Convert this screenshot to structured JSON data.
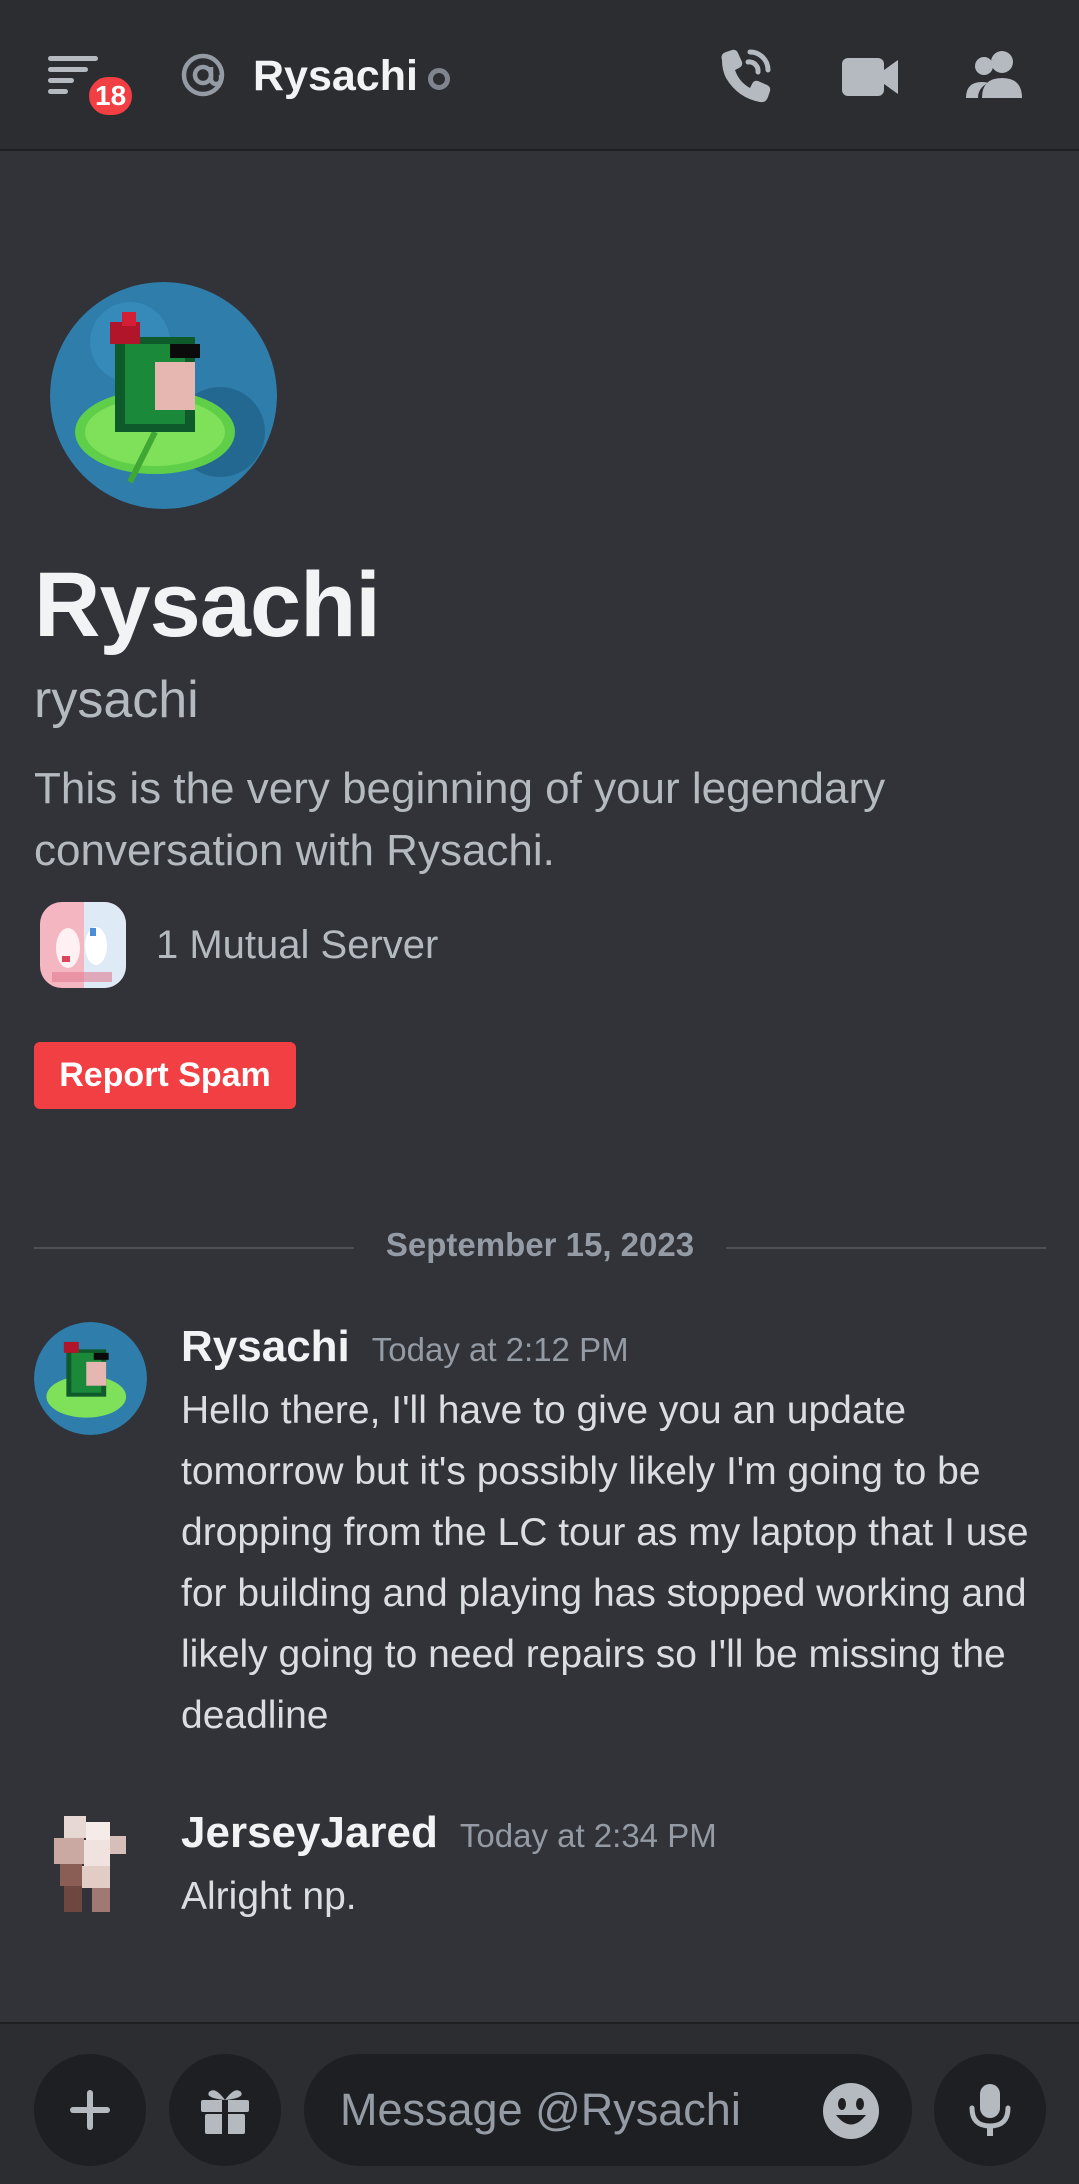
{
  "header": {
    "notification_count": "18",
    "title": "Rysachi",
    "icons": [
      "hamburger-menu-icon",
      "at-icon",
      "phone-call-icon",
      "video-camera-icon",
      "members-icon"
    ]
  },
  "intro": {
    "display_name": "Rysachi",
    "username": "rysachi",
    "description": "This is the very beginning of your legendary conversation with Rysachi.",
    "mutual_servers": "1 Mutual Server",
    "report_button": "Report Spam"
  },
  "divider": {
    "date": "September 15, 2023"
  },
  "messages": [
    {
      "author": "Rysachi",
      "time": "Today at 2:12 PM",
      "text": "Hello there, I'll have to give you an update tomorrow but it's possibly likely I'm going to be dropping from the LC tour as my laptop that I use for building and playing has stopped working and likely going to need repairs so I'll be missing the deadline"
    },
    {
      "author": "JerseyJared",
      "time": "Today at 2:34 PM",
      "text": "Alright np."
    }
  ],
  "composer": {
    "placeholder": "Message @Rysachi",
    "icons": [
      "plus-icon",
      "gift-icon",
      "emoji-icon",
      "microphone-icon"
    ]
  },
  "colors": {
    "background": "#313338",
    "header": "#2b2d31",
    "accent_red": "#f23f43",
    "muted_text": "#b5bac1"
  }
}
